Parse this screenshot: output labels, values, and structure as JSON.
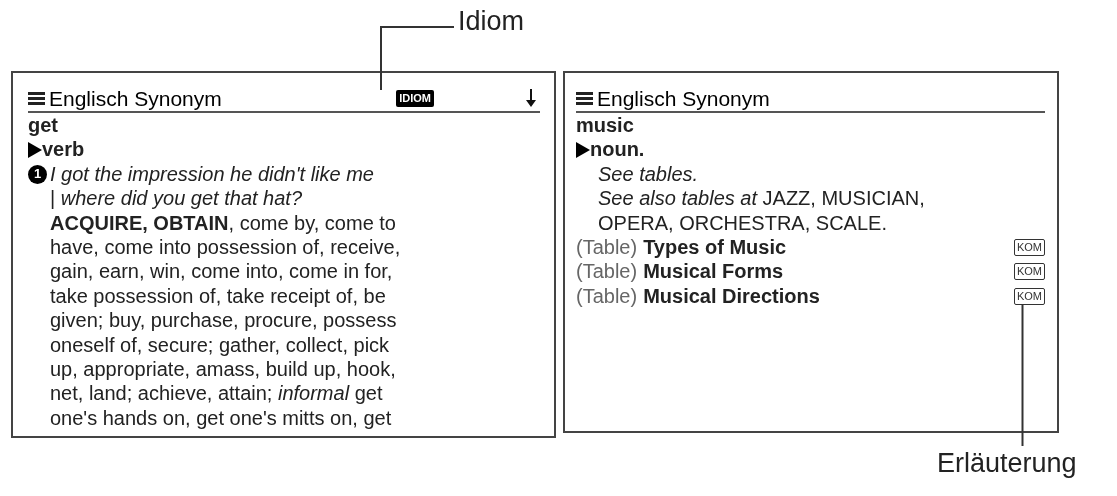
{
  "callouts": [
    {
      "label": "Idiom"
    },
    {
      "label": "Erläuterung"
    }
  ],
  "screens": [
    {
      "title": "Englisch Synonym",
      "badge": "IDIOM",
      "scroll_down": true,
      "headword": "get",
      "part_of_speech": "verb",
      "sense_number": "1",
      "lines": [
        "*I got the impression he didn't like me*",
        "| *where did you get that hat?*",
        "**ACQUIRE, OBTAIN**, come by, come to",
        "have, come into possession of, receive,",
        "gain, earn, win, come into, come in for,",
        "take possession of, take receipt of, be",
        "given; buy, purchase, procure, possess",
        "oneself of, secure; gather, collect, pick",
        "up, appropriate, amass, build up, hook,",
        "net, land; achieve, attain; *informal* get",
        "one's hands on, get one's mitts on, get"
      ]
    },
    {
      "title": "Englisch Synonym",
      "scroll_down": false,
      "headword": "music",
      "part_of_speech": "noun.",
      "lines": [
        "*See tables.*",
        "*See also tables at* JAZZ, MUSICIAN,",
        "OPERA, ORCHESTRA, SCALE."
      ],
      "tables": [
        {
          "prefix": "(Table)",
          "name": "Types of Music",
          "badge": "KOM"
        },
        {
          "prefix": "(Table)",
          "name": "Musical Forms",
          "badge": "KOM"
        },
        {
          "prefix": "(Table)",
          "name": "Musical Directions",
          "badge": "KOM"
        }
      ]
    }
  ]
}
